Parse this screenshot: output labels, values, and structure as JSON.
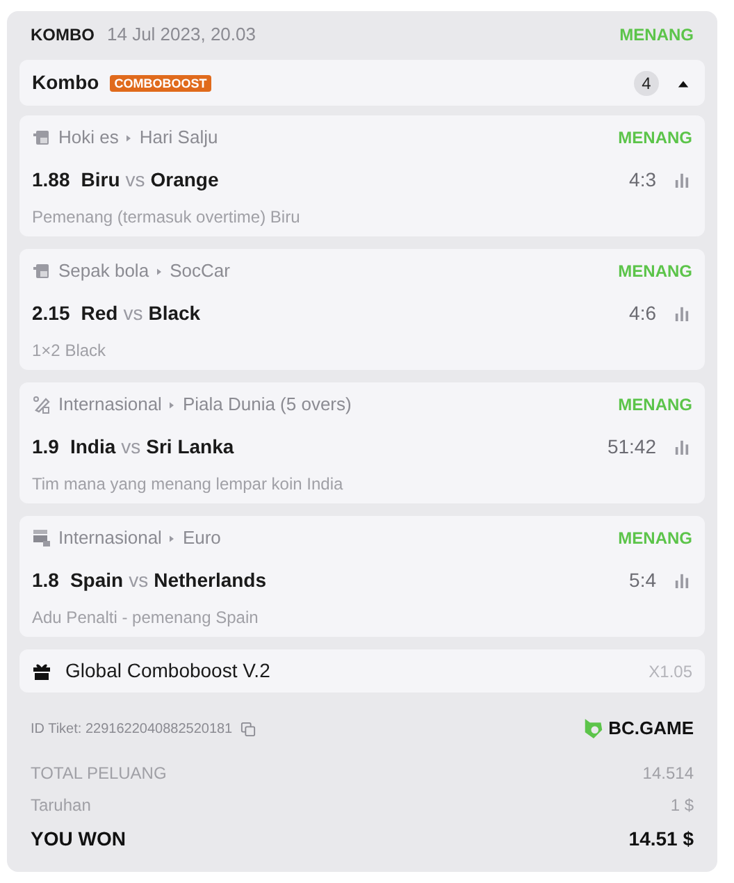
{
  "header": {
    "type": "KOMBO",
    "date": "14 Jul 2023, 20.03",
    "status": "MENANG"
  },
  "combo": {
    "title": "Kombo",
    "badge": "COMBOBOOST",
    "count": "4",
    "expanded": true
  },
  "events": [
    {
      "kind": "virtual",
      "sport": "Hoki es",
      "league": "Hari Salju",
      "status": "MENANG",
      "odds": "1.88",
      "home": "Biru",
      "vs": "vs",
      "away": "Orange",
      "score": "4:3",
      "market": "Pemenang (termasuk overtime) Biru"
    },
    {
      "kind": "virtual",
      "sport": "Sepak bola",
      "league": "SocCar",
      "status": "MENANG",
      "odds": "2.15",
      "home": "Red",
      "vs": "vs",
      "away": "Black",
      "score": "4:6",
      "market": "1×2 Black"
    },
    {
      "kind": "cricket",
      "sport": "Internasional",
      "league": "Piala Dunia (5 overs)",
      "status": "MENANG",
      "odds": "1.9",
      "home": "India",
      "vs": "vs",
      "away": "Sri Lanka",
      "score": "51:42",
      "market": "Tim mana yang menang lempar koin India"
    },
    {
      "kind": "penalty",
      "sport": "Internasional",
      "league": "Euro",
      "status": "MENANG",
      "odds": "1.8",
      "home": "Spain",
      "vs": "vs",
      "away": "Netherlands",
      "score": "5:4",
      "market": "Adu Penalti - pemenang Spain"
    }
  ],
  "boost": {
    "title": "Global Comboboost V.2",
    "multiplier": "X1.05"
  },
  "ticket": {
    "id": "ID Tiket: 2291622040882520181",
    "brand": "BC.GAME"
  },
  "totals": [
    {
      "kind": "muted",
      "label": "TOTAL PELUANG",
      "value": "14.514"
    },
    {
      "kind": "muted",
      "label": "Taruhan",
      "value": "1 $"
    },
    {
      "kind": "strong",
      "label": "YOU WON",
      "value": "14.51 $"
    }
  ]
}
